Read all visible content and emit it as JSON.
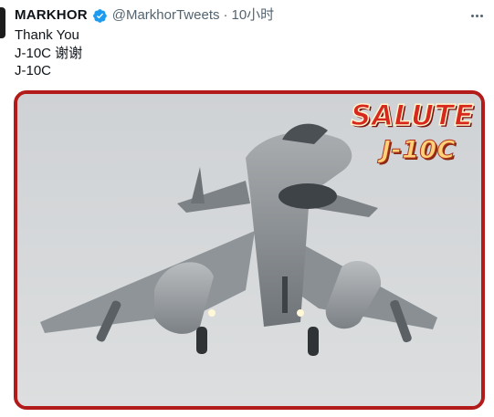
{
  "tweet": {
    "author_name": "MARKHOR",
    "handle": "@MarkhorTweets",
    "separator": "·",
    "time": "10小时",
    "text_lines": [
      "Thank You",
      "J-10C 谢谢",
      "J-10C"
    ]
  },
  "media": {
    "overlay_title": "SALUTE",
    "overlay_subtitle": "J-10C",
    "border_color": "#b31b1b"
  },
  "icons": {
    "verified": "verified-badge-icon",
    "more": "more-options-icon"
  },
  "colors": {
    "verified_blue": "#1d9bf0",
    "secondary_text": "#536471",
    "primary_text": "#0f1419"
  }
}
